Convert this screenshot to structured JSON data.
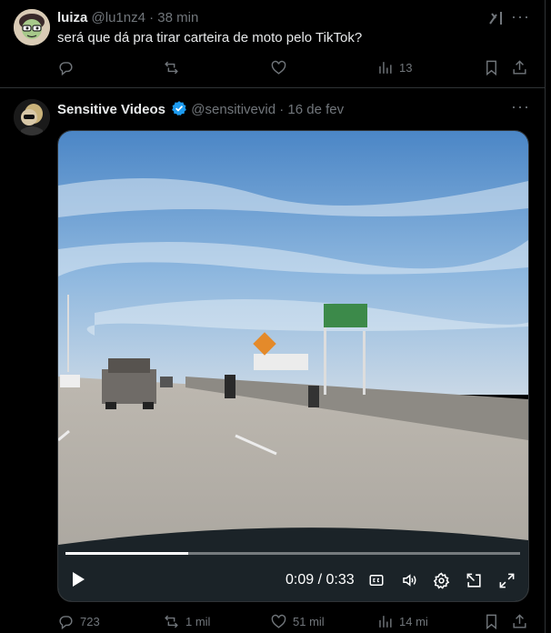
{
  "tweet1": {
    "name": "luiza",
    "handle": "@lu1nz4",
    "sep": "·",
    "time": "38 min",
    "text": "será que dá pra tirar carteira de moto pelo TikTok?",
    "views": "13"
  },
  "tweet2": {
    "name": "Sensitive Videos",
    "handle": "@sensitivevid",
    "sep": "·",
    "date": "16 de fev",
    "video": {
      "current_time": "0:09",
      "duration": "0:33",
      "time_sep": "/",
      "progress": 0.27
    },
    "replies": "723",
    "retweets": "1 mil",
    "likes": "51 mil",
    "views": "14 mi"
  },
  "colors": {
    "background": "#000000",
    "text": "#e7e9ea",
    "muted": "#71767b",
    "verified": "#1d9bf0"
  }
}
